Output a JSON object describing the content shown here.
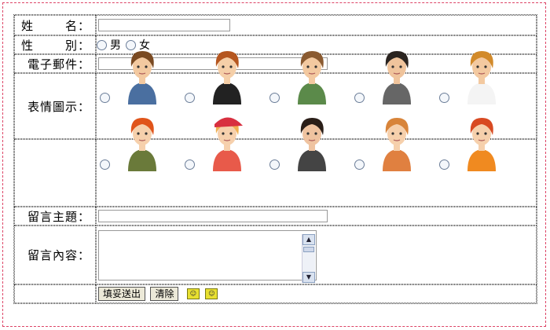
{
  "form": {
    "name_label": "姓名：",
    "name_chars": [
      "姓",
      "名"
    ],
    "gender_label": "性別：",
    "gender_chars": [
      "性",
      "別"
    ],
    "gender_options": [
      "男",
      "女"
    ],
    "email_label": "電子郵件：",
    "avatar_label": "表情圖示：",
    "subject_label": "留言主題：",
    "content_label": "留言內容：",
    "submit_label": "填妥送出",
    "clear_label": "清除",
    "name_value": "",
    "email_value": "",
    "subject_value": "",
    "content_value": ""
  },
  "avatars": {
    "row1": [
      "boy-brown-spiky-jacket",
      "boy-auburn-suit",
      "boy-spiky-green-sweater",
      "boy-dark-hair-vest",
      "boy-blond-tank"
    ],
    "row2": [
      "girl-red-pigtails-green",
      "girl-red-cap-blond",
      "girl-dark-long-hair",
      "girl-sunglasses-blond",
      "girl-red-updo"
    ]
  },
  "colors": {
    "outer_border": "#dd4466",
    "dotted_border": "#555555",
    "radio_border": "#6b7d98"
  }
}
